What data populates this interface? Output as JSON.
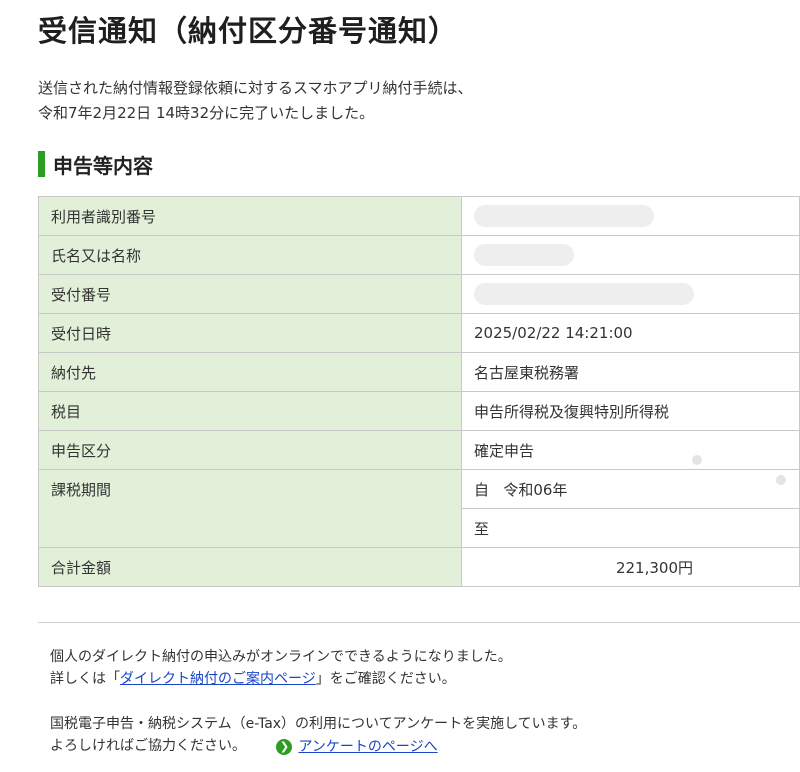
{
  "page": {
    "title": "受信通知（納付区分番号通知）",
    "intro_line1": "送信された納付情報登録依頼に対するスマホアプリ納付手続は、",
    "intro_line2": "令和7年2月22日 14時32分に完了いたしました。",
    "section_heading": "申告等内容"
  },
  "table": {
    "user_id": {
      "label": "利用者識別番号",
      "value": ""
    },
    "name": {
      "label": "氏名又は名称",
      "value": ""
    },
    "receipt_no": {
      "label": "受付番号",
      "value": ""
    },
    "receipt_datetime": {
      "label": "受付日時",
      "value": "2025/02/22 14:21:00"
    },
    "payee": {
      "label": "納付先",
      "value": "名古屋東税務署"
    },
    "tax_item": {
      "label": "税目",
      "value": "申告所得税及復興特別所得税"
    },
    "filing_type": {
      "label": "申告区分",
      "value": "確定申告"
    },
    "tax_period": {
      "label": "課税期間",
      "from_prefix": "自",
      "from_value": "令和06年",
      "to_prefix": "至"
    },
    "total": {
      "label": "合計金額",
      "value": "221,300円"
    }
  },
  "notice": {
    "direct_line1": "個人のダイレクト納付の申込みがオンラインでできるようになりました。",
    "direct_line2_before": "詳しくは「",
    "direct_link": "ダイレクト納付のご案内ページ",
    "direct_line2_after": "」をご確認ください。",
    "survey_line1": "国税電子申告・納税システム（e-Tax）の利用についてアンケートを実施しています。",
    "survey_line2": "よろしければご協力ください。",
    "survey_link": "アンケートのページへ"
  },
  "colors": {
    "label_bg": "#e2f0d9",
    "accent_green": "#2e9d23",
    "link": "#1a45c7"
  },
  "icons": {
    "survey_arrow": "chevron-right-circle-icon"
  }
}
